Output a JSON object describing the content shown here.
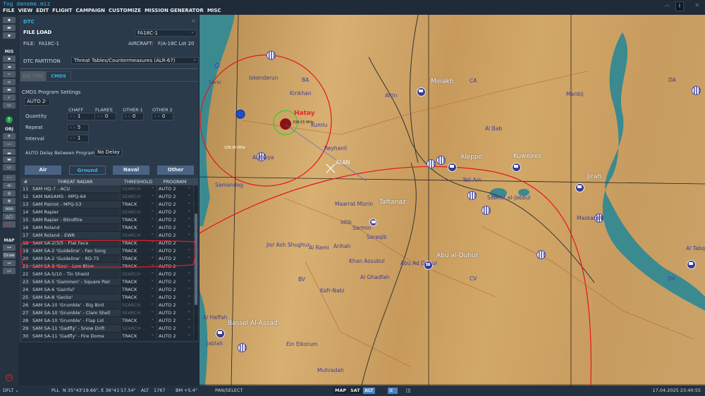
{
  "window": {
    "title": "fog deneme.miz"
  },
  "menu": [
    "FILE",
    "VIEW",
    "EDIT",
    "FLIGHT",
    "CAMPAIGN",
    "CUSTOMIZE",
    "MISSION GENERATOR",
    "MISC"
  ],
  "toolbar": {
    "mis_label": "MIS",
    "obj_label": "OBJ",
    "map_label": "MAP",
    "draw_label": "Draw"
  },
  "dtc": {
    "title": "DTC",
    "close": "×",
    "tab_file": "FILE",
    "tab_load": "LOAD",
    "aircraft_select": "FA18C-1",
    "file_label": "FILE:",
    "file_value": "FA18C-1",
    "aircraft_label": "AIRCRAFT:",
    "aircraft_value": "F/A-18C Lot 20",
    "partition_label": "DTC PARTITION",
    "partition_value": "Threat Tables/Countermeasures (ALR-67)",
    "subtabs": [
      "DIS TYPE",
      "CMDS"
    ],
    "cmds_title": "CMDS Program Settings",
    "program_select": "AUTO 2",
    "columns": [
      "CHAFF",
      "FLARES",
      "OTHER 1",
      "OTHER 2"
    ],
    "rows": {
      "quantity": "Quantity",
      "repeat": "Repeat",
      "interval": "Interval"
    },
    "quantity": [
      "1",
      "0",
      "0",
      "0"
    ],
    "repeat": "5",
    "interval": "1",
    "auto_delay_label": "AUTO Delay Between Programs",
    "auto_delay_value": "No Delay",
    "categories": [
      "Air",
      "Ground",
      "Naval",
      "Other"
    ],
    "active_category": "Ground",
    "table": {
      "headers": [
        "#",
        "THREAT RADAR",
        "THRESHOLD",
        "PROGRAM"
      ],
      "rows": [
        {
          "n": "11",
          "name": "SAM HQ-7 - ACU",
          "threshold": "SEARCH",
          "program": "AUTO 2"
        },
        {
          "n": "12",
          "name": "SAM NASAMS - MPQ-64",
          "threshold": "SEARCH",
          "program": "AUTO 2"
        },
        {
          "n": "13",
          "name": "SAM Patriot - MPQ-53",
          "threshold": "TRACK",
          "program": "AUTO 2"
        },
        {
          "n": "14",
          "name": "SAM Rapier",
          "threshold": "SEARCH",
          "program": "AUTO 2"
        },
        {
          "n": "15",
          "name": "SAM Rapier - Blindfire",
          "threshold": "TRACK",
          "program": "AUTO 2"
        },
        {
          "n": "16",
          "name": "SAM Roland",
          "threshold": "TRACK",
          "program": "AUTO 2"
        },
        {
          "n": "17",
          "name": "SAM Roland - EWR",
          "threshold": "SEARCH",
          "program": "AUTO 2"
        },
        {
          "n": "18",
          "name": "SAM SA-2/3/5 - Flat Face",
          "threshold": "TRACK",
          "program": "AUTO 2"
        },
        {
          "n": "19",
          "name": "SAM SA-2 'Guideline' - Fan Song",
          "threshold": "TRACK",
          "program": "AUTO 2"
        },
        {
          "n": "20",
          "name": "SAM SA-2 'Guideline' - RD-75",
          "threshold": "TRACK",
          "program": "AUTO 2"
        },
        {
          "n": "21",
          "name": "SAM SA-3 'Goa' - Low Blow",
          "threshold": "TRACK",
          "program": "AUTO 2"
        },
        {
          "n": "22",
          "name": "SAM SA-5/10 - Tin Shield",
          "threshold": "SEARCH",
          "program": "AUTO 2"
        },
        {
          "n": "23",
          "name": "SAM SA-5 'Gammon' - Square Pair",
          "threshold": "TRACK",
          "program": "AUTO 2"
        },
        {
          "n": "24",
          "name": "SAM SA-6 'Gainful'",
          "threshold": "TRACK",
          "program": "AUTO 2"
        },
        {
          "n": "25",
          "name": "SAM SA-8 'Gecko'",
          "threshold": "TRACK",
          "program": "AUTO 2"
        },
        {
          "n": "26",
          "name": "SAM SA-10 'Grumble' - Big Bird",
          "threshold": "SEARCH",
          "program": "AUTO 2"
        },
        {
          "n": "27",
          "name": "SAM SA-10 'Grumble' - Clam Shell",
          "threshold": "SEARCH",
          "program": "AUTO 2"
        },
        {
          "n": "28",
          "name": "SAM SA-10 'Grumble' - Flap Lid",
          "threshold": "TRACK",
          "program": "AUTO 2"
        },
        {
          "n": "29",
          "name": "SAM SA-11 'Gadfly' - Snow Drift",
          "threshold": "SEARCH",
          "program": "AUTO 2"
        },
        {
          "n": "30",
          "name": "SAM SA-11 'Gadfly' - Fire Dome",
          "threshold": "TRACK",
          "program": "AUTO 2"
        }
      ]
    }
  },
  "map": {
    "labels": [
      "Minakh",
      "CA",
      "Manbij",
      "DA",
      "Al Bab",
      "Aleppo",
      "Kuweires",
      "Jirah",
      "Tell Arn",
      "Sabhat al-Jabbul",
      "Iskenderun",
      "BA",
      "Kirikhan",
      "Afrin",
      "Hatay",
      "Kumlu",
      "Reyhanli",
      "ALAN",
      "Antakya",
      "Samandag",
      "Maarrat Misrin",
      "Taftanaz",
      "Idlib",
      "Sarmin",
      "Saraqib",
      "Jisr Ash Shughur",
      "Al Rami",
      "Arihah",
      "Khan Assubul",
      "Abu al-Duhur",
      "Abu Ad Duhur",
      "CV",
      "Al Ghadfah",
      "BV",
      "Kafr-Nabi",
      "Bassel Al-Assad",
      "Jablah",
      "Ein Elkorum",
      "Muhradah",
      "Maskanah",
      "Al Tabqah",
      "DV",
      "Al Haffah",
      "Sarsi"
    ],
    "freq_labels": [
      "108.90 MHz",
      "338.05 MHz"
    ]
  },
  "status": {
    "profile": "DFLT",
    "coord_mode": "PLL",
    "coords": "N 35°43'19.66\", E 36°41'17.54\"",
    "alt_label": "ALT",
    "alt_value": "1767",
    "bm": "BM",
    "bm_value": "+5.4°",
    "mode": "PAN/SELECT",
    "map_buttons": [
      "MAP",
      "SAT",
      "ALT"
    ],
    "active_map": "ALT",
    "datetime": "17.04.2025 23:40:55"
  }
}
